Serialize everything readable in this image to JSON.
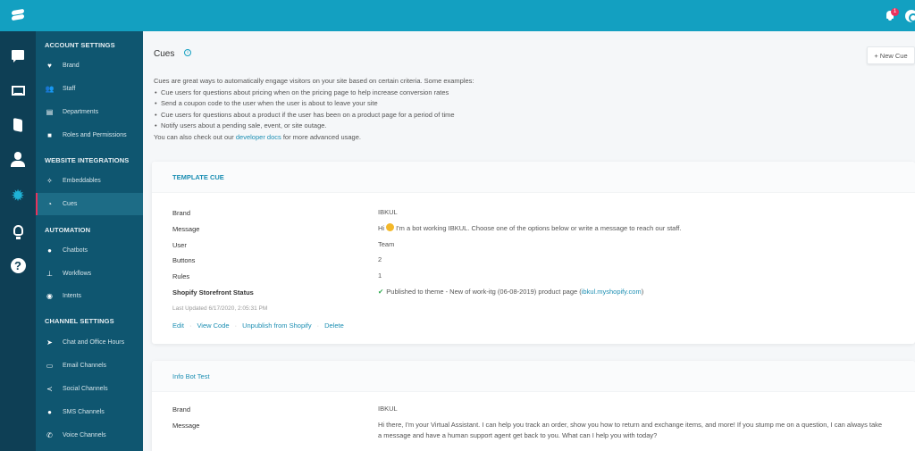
{
  "topbar": {
    "notifications_count": "1"
  },
  "rail": {
    "items": [
      {
        "icon": "chat-icon",
        "active": false
      },
      {
        "icon": "reports-icon",
        "active": false
      },
      {
        "icon": "knowledge-base-icon",
        "active": false
      },
      {
        "icon": "contacts-icon",
        "active": false
      },
      {
        "icon": "settings-gear-icon",
        "active": true
      },
      {
        "icon": "lightbulb-icon",
        "active": false
      },
      {
        "icon": "help-icon",
        "active": false
      }
    ]
  },
  "sidebar": {
    "sections": [
      {
        "title": "ACCOUNT SETTINGS",
        "items": [
          {
            "label": "Brand",
            "icon": "heart-icon"
          },
          {
            "label": "Staff",
            "icon": "staff-icon"
          },
          {
            "label": "Departments",
            "icon": "id-card-icon"
          },
          {
            "label": "Roles and Permissions",
            "icon": "briefcase-icon"
          }
        ]
      },
      {
        "title": "WEBSITE INTEGRATIONS",
        "items": [
          {
            "label": "Embeddables",
            "icon": "magic-wand-icon"
          },
          {
            "label": "Cues",
            "icon": "rss-icon",
            "active": true
          }
        ]
      },
      {
        "title": "AUTOMATION",
        "items": [
          {
            "label": "Chatbots",
            "icon": "robot-icon"
          },
          {
            "label": "Workflows",
            "icon": "sitemap-icon"
          },
          {
            "label": "Intents",
            "icon": "intents-icon"
          }
        ]
      },
      {
        "title": "CHANNEL SETTINGS",
        "items": [
          {
            "label": "Chat and Office Hours",
            "icon": "paper-plane-icon"
          },
          {
            "label": "Email Channels",
            "icon": "inbox-icon"
          },
          {
            "label": "Social Channels",
            "icon": "share-icon"
          },
          {
            "label": "SMS Channels",
            "icon": "sms-icon"
          },
          {
            "label": "Voice Channels",
            "icon": "phone-icon"
          }
        ]
      }
    ]
  },
  "main": {
    "title": "Cues",
    "new_button": "+ New Cue",
    "intro": "Cues are great ways to automatically engage visitors on your site based on certain criteria. Some examples:",
    "examples": [
      "Cue users for questions about pricing when on the pricing page to help increase conversion rates",
      "Send a coupon code to the user when the user is about to leave your site",
      "Cue users for questions about a product if the user has been on a product page for a period of time",
      "Notify users about a pending sale, event, or site outage."
    ],
    "footer_prefix": "You can also check out our ",
    "footer_link": "developer docs",
    "footer_suffix": " for more advanced usage.",
    "cards": [
      {
        "title": "TEMPLATE CUE",
        "labels": {
          "brand": "Brand",
          "message": "Message",
          "user": "User",
          "buttons": "Buttons",
          "rules": "Rules",
          "shopify": "Shopify Storefront Status"
        },
        "brand": "IBKUL",
        "message_prefix": "Hi",
        "message": "I'm a bot working IBKUL. Choose one of the options below or write a message to reach our staff.",
        "user": "Team",
        "buttons": "2",
        "rules": "1",
        "shopify_status": "Published to theme - New of work-itg (06-08-2019) product page (",
        "shopify_link": "ibkul.myshopify.com",
        "shopify_close": ")",
        "last_updated": "Last Updated 6/17/2020, 2:05:31 PM",
        "actions": [
          "Edit",
          "View Code",
          "Unpublish from Shopify",
          "Delete"
        ]
      },
      {
        "title": "Info Bot Test",
        "labels": {
          "brand": "Brand",
          "message": "Message"
        },
        "brand": "IBKUL",
        "message": "Hi there, I'm your Virtual Assistant. I can help you track an order, show you how to return and exchange items, and more! If you stump me on a question, I can always take a message and have a human support agent get back to you. What can I help you with today?"
      }
    ]
  }
}
